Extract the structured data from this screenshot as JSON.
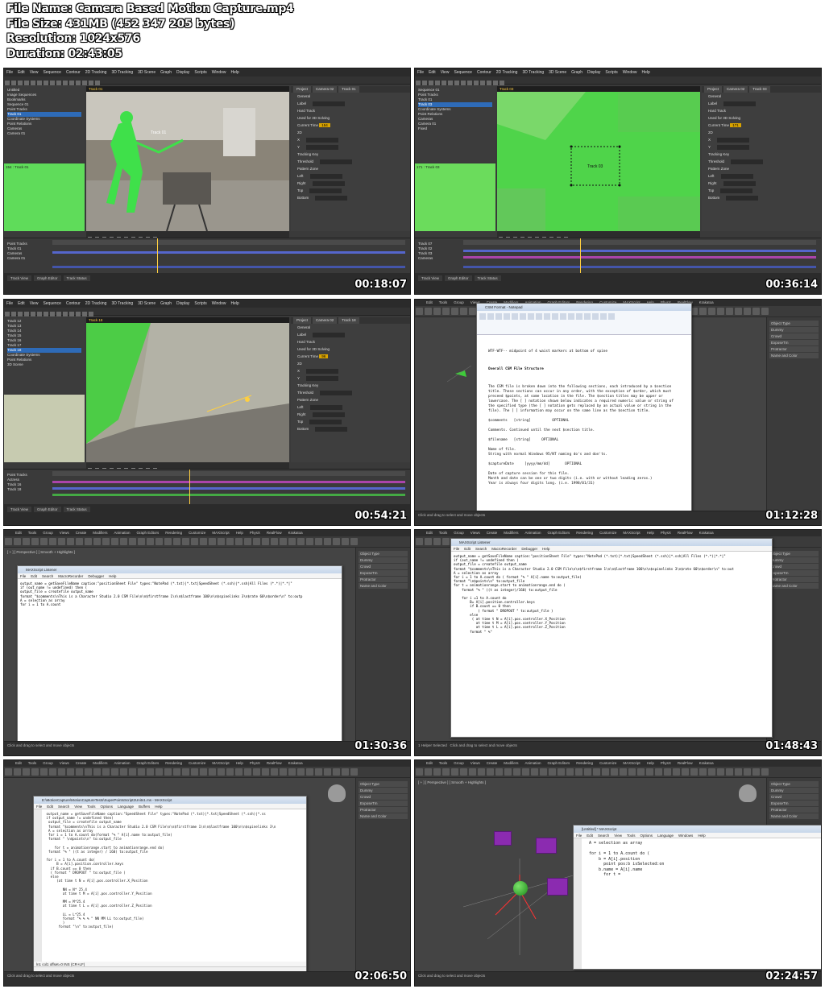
{
  "info": {
    "file_name": "File Name: Camera Based Motion Capture.mp4",
    "file_size": "File Size: 431MB (452 347 205 bytes)",
    "resolution": "Resolution: 1024x576",
    "duration": "Duration: 02:43:05"
  },
  "thumbnails": [
    {
      "timestamp": "00:18:07",
      "viewer_title": "Track 01",
      "track_label": "Track 01",
      "current_time": "154",
      "preview_label": "154 : Track 01"
    },
    {
      "timestamp": "00:36:14",
      "viewer_title": "Track 03",
      "track_label": "Track 03",
      "current_time": "171",
      "preview_label": "171 : Track 03"
    },
    {
      "timestamp": "00:54:21",
      "viewer_title": "Track 18",
      "track_label": "Track 18",
      "current_time": "96",
      "preview_label": ""
    },
    {
      "timestamp": "01:12:28"
    },
    {
      "timestamp": "01:30:36"
    },
    {
      "timestamp": "01:48:43"
    },
    {
      "timestamp": "02:06:50"
    },
    {
      "timestamp": "02:24:57"
    }
  ],
  "tracker_app": {
    "menu": [
      "File",
      "Edit",
      "View",
      "Sequence",
      "Contour",
      "2D Tracking",
      "3D Tracking",
      "3D Scene",
      "Graph",
      "Display",
      "Scripts",
      "Window",
      "Help"
    ],
    "tree": [
      "Untitled",
      "Image Sequences",
      "Bookmarks",
      "Sequence 01",
      "Point Tracks",
      "Track 01",
      "Coordinate Systems",
      "Point Relations",
      "Cameras",
      "Camera 01"
    ],
    "tree_b": [
      "Sequence 01",
      "Point Tracks",
      "Track 01",
      "Track 03",
      "Coordinate Systems",
      "Point Relations",
      "Cameras",
      "Camera 01",
      "Fixed"
    ],
    "tree_c": [
      "Track 12",
      "Track 13",
      "Track 14",
      "Track 15",
      "Track 16",
      "Track 17",
      "Track 18",
      "Coordinate Systems",
      "Point Relations",
      "3D Scene"
    ],
    "props_tabs": [
      "Project",
      "Camera 02",
      "Track 01"
    ],
    "props_rows": [
      "General",
      "Label",
      "Hard Track",
      "Used for 3D Solving",
      "Current Time",
      "2D",
      "X",
      "Y",
      "Tracking Key",
      "Threshold",
      "Pattern Zone",
      "Left",
      "Right",
      "Top",
      "Bottom"
    ],
    "timeline_tracks": [
      "Point Tracks",
      "Track 01",
      "Cameras",
      "Camera 01"
    ],
    "status_tabs": [
      "Track View",
      "Graph Editor",
      "Track Status"
    ]
  },
  "max_app": {
    "menu": [
      "Edit",
      "Tools",
      "Group",
      "Views",
      "Create",
      "Modifiers",
      "Animation",
      "Graph Editors",
      "Rendering",
      "Customize",
      "MAXScript",
      "Help",
      "PhysX",
      "RealFlow",
      "Krakatoa"
    ],
    "viewport_label": "[ + ] [ Perspective ] [ Smooth + Highlights ]",
    "cmd_items": [
      "Object Type",
      "Dummy",
      "Crowd",
      "ExposeTm",
      "Protractor",
      "Name and Color"
    ],
    "status_text": "Click and drag to select and move objects",
    "status_sel": "1 Helper Selected"
  },
  "notepad": {
    "title": "CSM Format - Notepad",
    "heading": "Overall CSM File Structure",
    "top_line": "WTF-WTF-- midpoint of 4 waist markers at bottom of spine",
    "body": "The CSM file is broken down into the following sections, each introduced by a $section title. These sections can occur in any order, with the exception of $order, which must preceed $points, at some location in the file. The $section titles may be upper or lowercase. The [ ] notation shown below indicates a required numeric value or string of the specified type (the [ ] notation gets replaced by an actual value or string in the file). The [ ] information may occur on the same line as the $section title.\n\n$comments   [string]          OPTIONAL\n\nComments. Continued until the next $section title.\n\n$filename   [string]     OPTIONAL\n\nName of file.\nString with normal Windows 95/NT naming do's and don'ts.\n\n$captureDate     [yyyy/mm/dd]       OPTIONAL\n\nDate of capture session for this file.\nMonth and date can be one or two digits (i.e. with or without leading zeros.)\nYear is always four digits long. (i.e. 1998/01/31)"
  },
  "listener_a": {
    "title": "MAXScript Listener",
    "menu": [
      "File",
      "Edit",
      "Search",
      "MacroRecorder",
      "Debugger",
      "Help"
    ],
    "code": "output_name = getSaveFileName caption:\"positionSheet File\" types:\"NotePad (*.txt)|*.txt|SpeedSheet (*.ssh)|*.ssh|All Files (*.*)|*.*|\"\nif (out_name != undefined) then (\noutput_file = createfile output_name\nformat \"$comments\\nThis is a Character Studio 2.0 CSM File\\n\\n$firstframe 1\\n\\n$lastframe 100\\n\\n$spinelinks 3\\n$rate 60\\n$order\\n\" to:outp\nA = selection as array\nfor i = 1 to A.count"
  },
  "listener_b": {
    "title": "MAXScript Listener",
    "menu": [
      "File",
      "Edit",
      "Search",
      "MacroRecorder",
      "Debugger",
      "Help"
    ],
    "code": "output_name = getSaveFileName caption:\"positionSheet File\" types:\"NotePad (*.txt)|*.txt|SpeedSheet (*.ssh)|*.ssh|All Files (*.*)|*.*|\"\nif (out_name != undefined then (\noutput_file = createfile output_name\nformat \"$comments\\nThis is a Character Studio 2.0 CSM File\\n\\n$firstframe 1\\n\\n$lastframe 100\\n\\n$spinelinks 3\\n$rate 60\\n$order\\n\" to:out\nA = selection as array\nfor i = 1 to A.count do ( format \"% \" A[i].name to:output_file)\nformat \"\\n$points\\n\" to:output_file\nfor t = animationrange.start to animationrange.end do (\n    format \"% \" ((t as integer)/160) to:output_file\n\n    for i =1 to A.count do\n        B= A[i].position.controller.keys\n        if B.count == 0 then\n            ( format \" DROPOUT \" to:output_file )\n        else\n         ( at time t N = A[i].pos.controller.X_Position\n           at time t M = A[i].pos.controller.Y_Position\n           at time t L = A[i].pos.controller.Z_Position\n        format \" %\""
  },
  "editor": {
    "title": "E:\\MotionCapture\\MotionCaptureTests\\SuperPointsScript2Units1.ms - MAXScript",
    "menu": [
      "File",
      "Edit",
      "Search",
      "View",
      "Tools",
      "Options",
      "Language",
      "Buffers",
      "Help"
    ],
    "code": " output_name = getSaveFileName caption:\"SpeedSheet File\" types:\"NotePad (*.txt)|*.txt|SpeedSheet (*.ssh)|*.ss\n if output_name != undefined then(\n  output_file = createfile output_name\n  format \"$comments\\nThis is a Character Studio 2.0 CSM File\\n\\n$firstframe 1\\n\\n$lastframe 100\\n\\n$spinelinks 3\\n\n  A = selection as array\n  for i = 1 to A.count do(format \"% \" A[i].name to:output_file)\n  format \" \\n$points\\n\" to:output_file\n\n     for t = animationrange.start to animationrange.end do(\n  format \"% \" ((t as integer) / 160) to:output_file\n\n for i = 1 to A.count do(\n      B = A[i].position.controller.keys\n   if B.count == 0 then\n   ( format \" DROPOUT \" to:output_file )\n   else\n      (at time t N = A[i].pos.controller.X_Position\n\n         NN = N* 25.4\n         at time t M = A[i].pos.controller.Y_Position\n\n         MM = M*25.4\n         at time t L = A[i].pos.controller.Z_Position\n\n         LL = L*25.4\n         format \"% % % \" NN MM LL to:output_file)\n         )\n       format \"\\n\" to:output_file)",
    "status": "ln1 col1 offset=0 INS (CR+LF)"
  },
  "editor_small": {
    "title": "[Untitled] * MAXScript",
    "menu": [
      "File",
      "Edit",
      "Search",
      "View",
      "Tools",
      "Options",
      "Language",
      "Windows",
      "Help"
    ],
    "code": "  A = selection as array\n\n  for i = 1 to A.count do (\n      b = A[i].position\n        point pos:b isSelected:on\n      b.name = A[i].name\n        for t = "
  }
}
